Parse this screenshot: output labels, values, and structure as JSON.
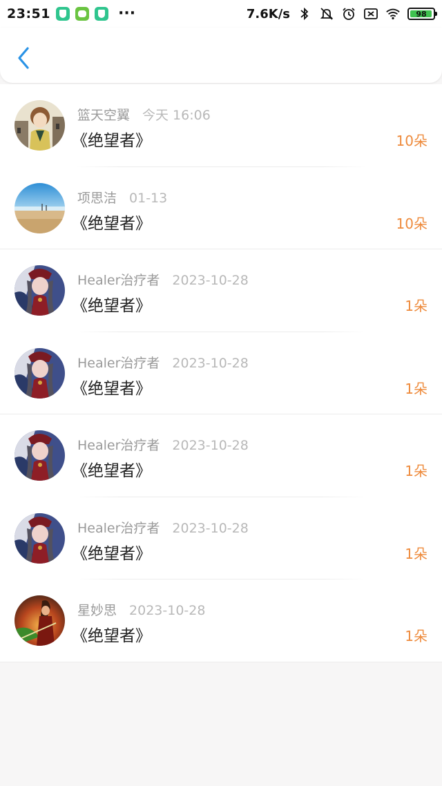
{
  "status_bar": {
    "time": "23:51",
    "dots": "···",
    "net_speed": "7.6K/s",
    "battery_level": "98",
    "icons": [
      "shield-app-icon",
      "bot-app-icon",
      "shield-app-icon",
      "bluetooth-icon",
      "mute-icon",
      "alarm-icon",
      "sim-off-icon",
      "wifi-icon",
      "battery-icon"
    ]
  },
  "header": {
    "back_icon": "chevron-left-icon",
    "accent": "#2a93e6"
  },
  "colors": {
    "amount": "#ee8a3b",
    "name": "#9a9a9a",
    "date": "#b8b8b8"
  },
  "items": [
    {
      "name": "篮天空翼",
      "date": "今天 16:06",
      "title": "《绝望者》",
      "amount": "10朵",
      "avatar": "boy-illustration-avatar"
    },
    {
      "name": "项思洁",
      "date": "01-13",
      "title": "《绝望者》",
      "amount": "10朵",
      "avatar": "beach-avatar"
    },
    {
      "name": "Healer治疗者",
      "date": "2023-10-28",
      "title": "《绝望者》",
      "amount": "1朵",
      "avatar": "anime-girl-avatar"
    },
    {
      "name": "Healer治疗者",
      "date": "2023-10-28",
      "title": "《绝望者》",
      "amount": "1朵",
      "avatar": "anime-girl-avatar"
    },
    {
      "name": "Healer治疗者",
      "date": "2023-10-28",
      "title": "《绝望者》",
      "amount": "1朵",
      "avatar": "anime-girl-avatar"
    },
    {
      "name": "Healer治疗者",
      "date": "2023-10-28",
      "title": "《绝望者》",
      "amount": "1朵",
      "avatar": "anime-girl-avatar"
    },
    {
      "name": "星妙思",
      "date": "2023-10-28",
      "title": "《绝望者》",
      "amount": "1朵",
      "avatar": "warrior-avatar"
    }
  ]
}
